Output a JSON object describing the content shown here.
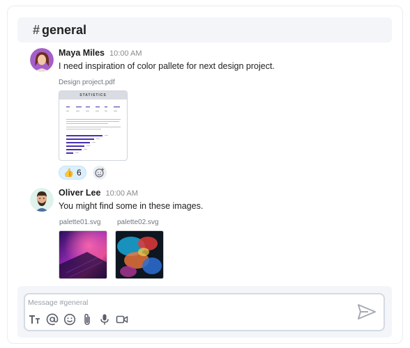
{
  "channel": {
    "hash": "#",
    "name": "general"
  },
  "messages": [
    {
      "author": "Maya Miles",
      "time": "10:00 AM",
      "text": "I need inspiration of color pallete for next design project.",
      "attachment": {
        "filename": "Design project.pdf",
        "heading": "STATISTICS"
      },
      "reaction": {
        "emoji": "👍",
        "count": "6"
      }
    },
    {
      "author": "Oliver Lee",
      "time": "10:00 AM",
      "text": "You might find some in these images.",
      "images": [
        {
          "filename": "palette01.svg"
        },
        {
          "filename": "palette02.svg"
        }
      ]
    }
  ],
  "composer": {
    "placeholder": "Message #general"
  },
  "icons": {
    "text_format": "text-format-icon",
    "mention": "at-mention-icon",
    "emoji": "emoji-icon",
    "attach": "paperclip-icon",
    "mic": "microphone-icon",
    "video": "video-camera-icon",
    "send": "send-icon"
  },
  "colors": {
    "accent": "#5b3fb0",
    "reaction_bg": "#dbeffd",
    "panel_bg": "#f3f5f9"
  }
}
